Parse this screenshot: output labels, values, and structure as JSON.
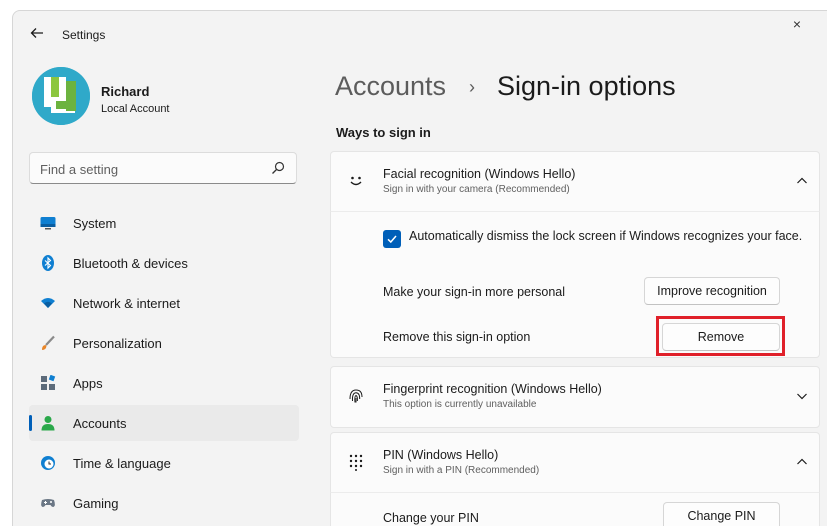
{
  "window": {
    "title": "Settings",
    "close_glyph": "×"
  },
  "profile": {
    "name": "Richard",
    "account_type": "Local Account"
  },
  "search": {
    "placeholder": "Find a setting"
  },
  "nav": [
    {
      "label": "System",
      "icon": "monitor-icon",
      "active": false
    },
    {
      "label": "Bluetooth & devices",
      "icon": "bluetooth-icon",
      "active": false
    },
    {
      "label": "Network & internet",
      "icon": "wifi-icon",
      "active": false
    },
    {
      "label": "Personalization",
      "icon": "brush-icon",
      "active": false
    },
    {
      "label": "Apps",
      "icon": "apps-icon",
      "active": false
    },
    {
      "label": "Accounts",
      "icon": "person-icon",
      "active": true
    },
    {
      "label": "Time & language",
      "icon": "clock-globe-icon",
      "active": false
    },
    {
      "label": "Gaming",
      "icon": "gamepad-icon",
      "active": false
    }
  ],
  "breadcrumb": {
    "parent": "Accounts",
    "separator": "›",
    "current": "Sign-in options"
  },
  "section": {
    "title": "Ways to sign in"
  },
  "facial": {
    "title": "Facial recognition (Windows Hello)",
    "subtitle": "Sign in with your camera (Recommended)",
    "auto_dismiss": {
      "checked": true,
      "label": "Automatically dismiss the lock screen if Windows recognizes your face."
    },
    "personal_label": "Make your sign-in more personal",
    "improve_button": "Improve recognition",
    "remove_label": "Remove this sign-in option",
    "remove_button": "Remove"
  },
  "fingerprint": {
    "title": "Fingerprint recognition (Windows Hello)",
    "subtitle": "This option is currently unavailable"
  },
  "pin": {
    "title": "PIN (Windows Hello)",
    "subtitle": "Sign in with a PIN (Recommended)",
    "change_label": "Change your PIN",
    "change_button": "Change PIN"
  },
  "colors": {
    "accent": "#005fb8",
    "highlight": "#e0202a",
    "background": "#f3f3f3",
    "card": "#fbfbfb"
  }
}
